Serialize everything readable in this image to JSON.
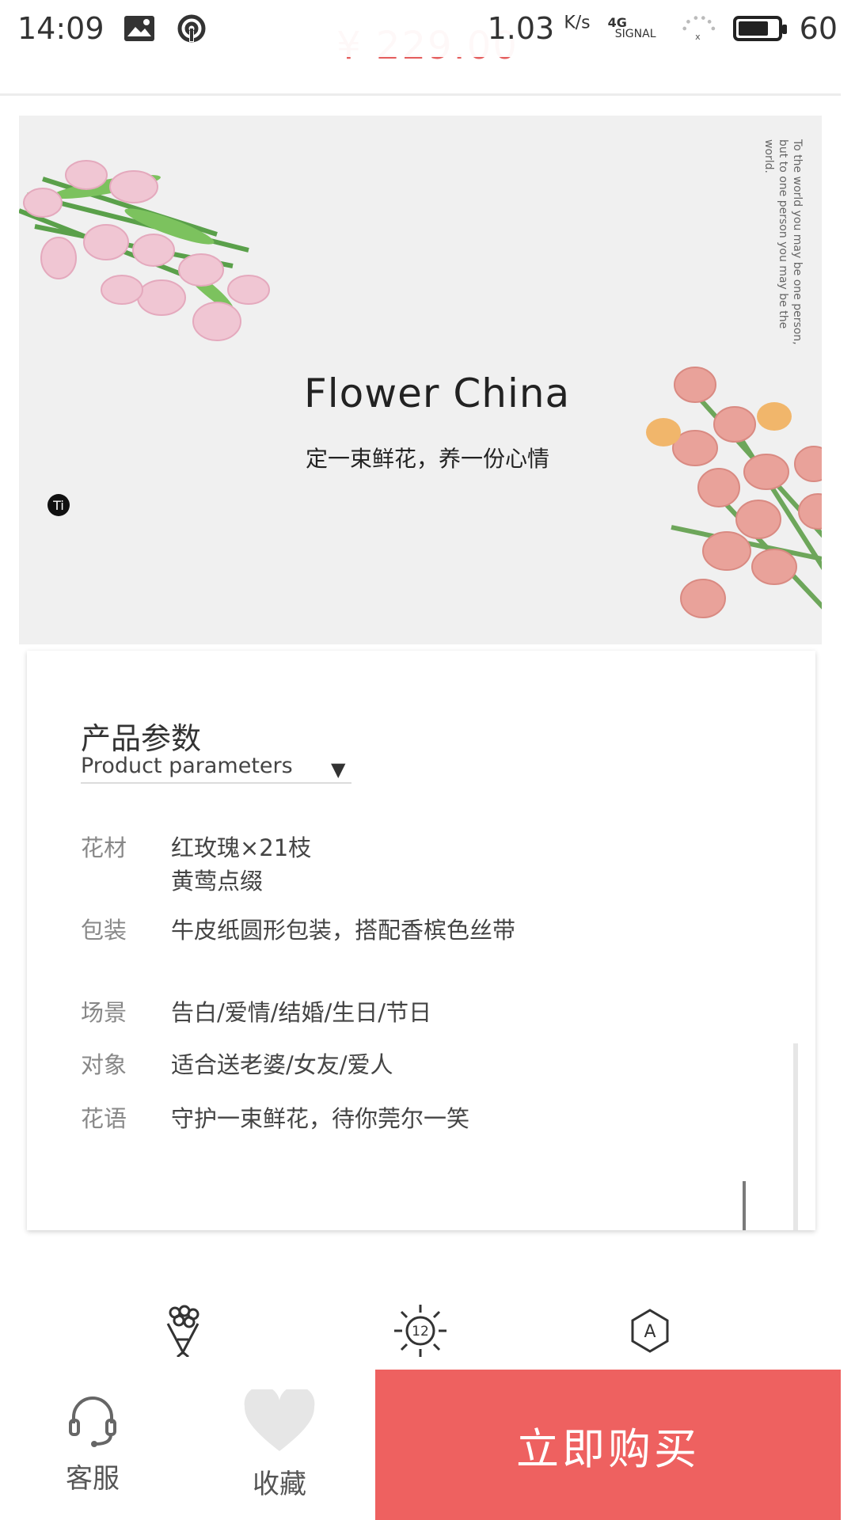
{
  "status_bar": {
    "time": "14:09",
    "speed": "1.03",
    "speed_unit": "K/s",
    "network_type": "4G",
    "signal_label": "SIGNAL",
    "battery": "60"
  },
  "price_peek": "¥ 229.00",
  "banner": {
    "title": "Flower China",
    "subtitle": "定一束鲜花，养一份心情",
    "vertical_text": "To the world you may be one person, but to one person you may be the world.",
    "badge": "Ti"
  },
  "params": {
    "title_cn": "产品参数",
    "title_en": "Product parameters",
    "toggle": "▼",
    "rows": [
      {
        "label": "花材",
        "value_line1": "红玫瑰×21枝",
        "value_line2": "黄莺点缀"
      },
      {
        "label": "包装",
        "value": "牛皮纸圆形包装，搭配香槟色丝带"
      },
      {
        "label": "场景",
        "value": "告白/爱情/结婚/生日/节日"
      },
      {
        "label": "对象",
        "value": "适合送老婆/女友/爱人"
      },
      {
        "label": "花语",
        "value": "守护一束鲜花，待你莞尔一笑"
      }
    ]
  },
  "feature_icons": [
    "bouquet-icon",
    "sun-12-icon",
    "hexagon-a-icon"
  ],
  "bottom_bar": {
    "service_label": "客服",
    "favorite_label": "收藏",
    "buy_label": "立即购买"
  },
  "colors": {
    "accent": "#ee6160",
    "price": "#e45c5c"
  }
}
